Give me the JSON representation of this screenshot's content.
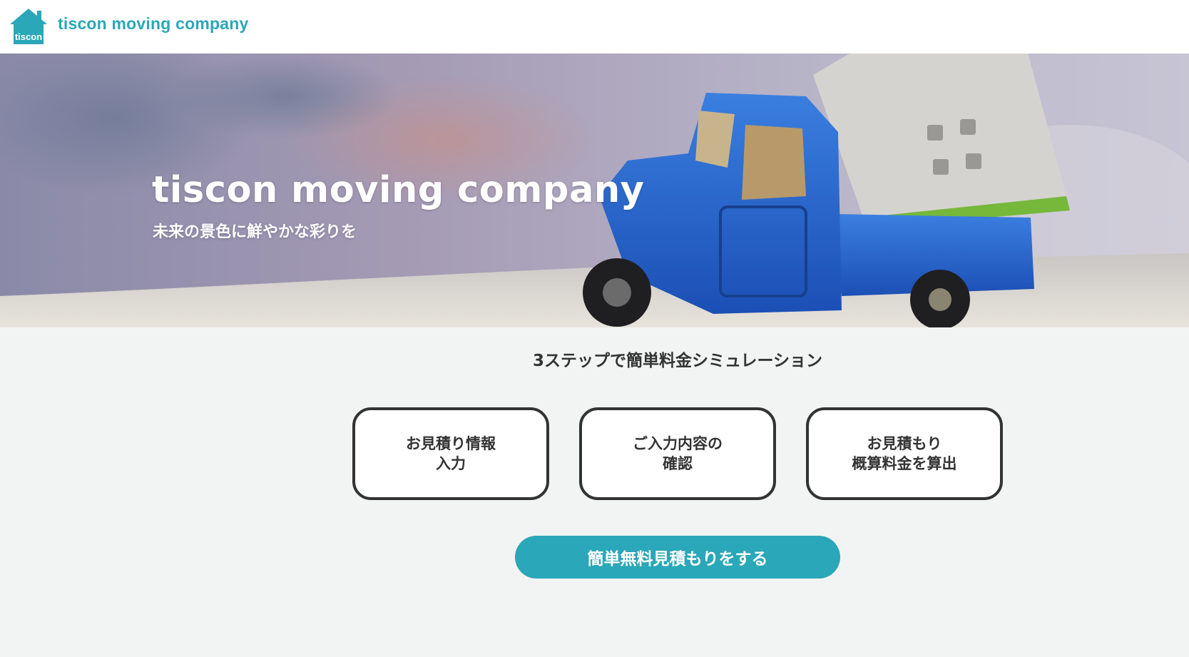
{
  "header": {
    "logo_text": "tiscon",
    "brand": "tiscon moving company"
  },
  "hero": {
    "title": "tiscon moving company",
    "subtitle": "未来の景色に鮮やかな彩りを"
  },
  "main": {
    "section_title": "3ステップで簡単料金シミュレーション",
    "steps": [
      {
        "line1": "お見積り情報",
        "line2": "入力"
      },
      {
        "line1": "ご入力内容の",
        "line2": "確認"
      },
      {
        "line1": "お見積もり",
        "line2": "概算料金を算出"
      }
    ],
    "cta_label": "簡単無料見積もりをする"
  },
  "colors": {
    "brand": "#2aa7b8",
    "text_dark": "#333333",
    "background": "#f2f4f3"
  },
  "icons": {
    "logo": "house-icon"
  }
}
